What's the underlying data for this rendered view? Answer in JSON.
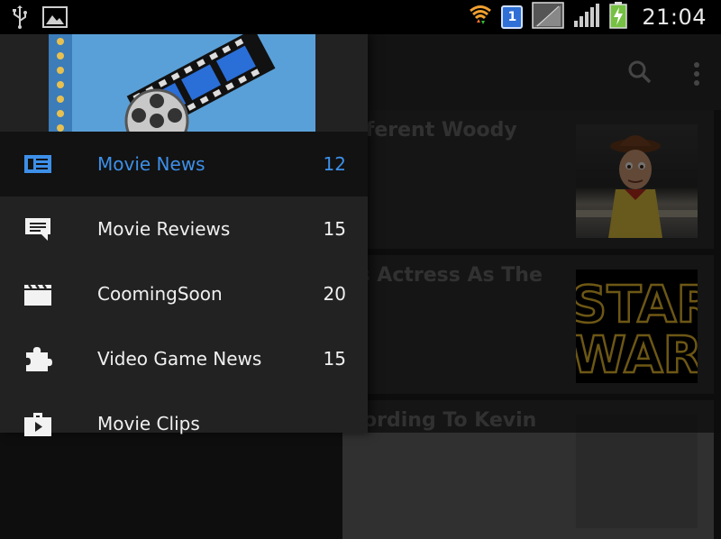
{
  "status_bar": {
    "notification_count": "1",
    "clock": "21:04",
    "icons": [
      "usb-icon",
      "image-icon",
      "wifi-icon",
      "signal-icon",
      "battery-charging-icon"
    ]
  },
  "app_bar": {
    "actions": [
      "search-icon",
      "overflow-menu-icon"
    ]
  },
  "cards": [
    {
      "title": "ifferent Woody",
      "thumbnail": "Woody"
    },
    {
      "title": "is Actress As The",
      "thumbnail": "STAR WARS"
    },
    {
      "title": "cording To Kevin",
      "thumbnail": ""
    }
  ],
  "drawer": {
    "items": [
      {
        "label": "Movie News",
        "count": "12",
        "icon": "news-icon",
        "active": true
      },
      {
        "label": "Movie Reviews",
        "count": "15",
        "icon": "comment-icon",
        "active": false
      },
      {
        "label": "CoomingSoon",
        "count": "20",
        "icon": "clapperboard-icon",
        "active": false
      },
      {
        "label": "Video Game News",
        "count": "15",
        "icon": "puzzle-icon",
        "active": false
      },
      {
        "label": "Movie Clips",
        "count": "",
        "icon": "briefcase-icon",
        "active": false
      }
    ]
  },
  "colors": {
    "accent": "#3d8fe8",
    "drawer_bg": "#222222",
    "active_bg": "#121212",
    "status_bar": "#000000"
  }
}
